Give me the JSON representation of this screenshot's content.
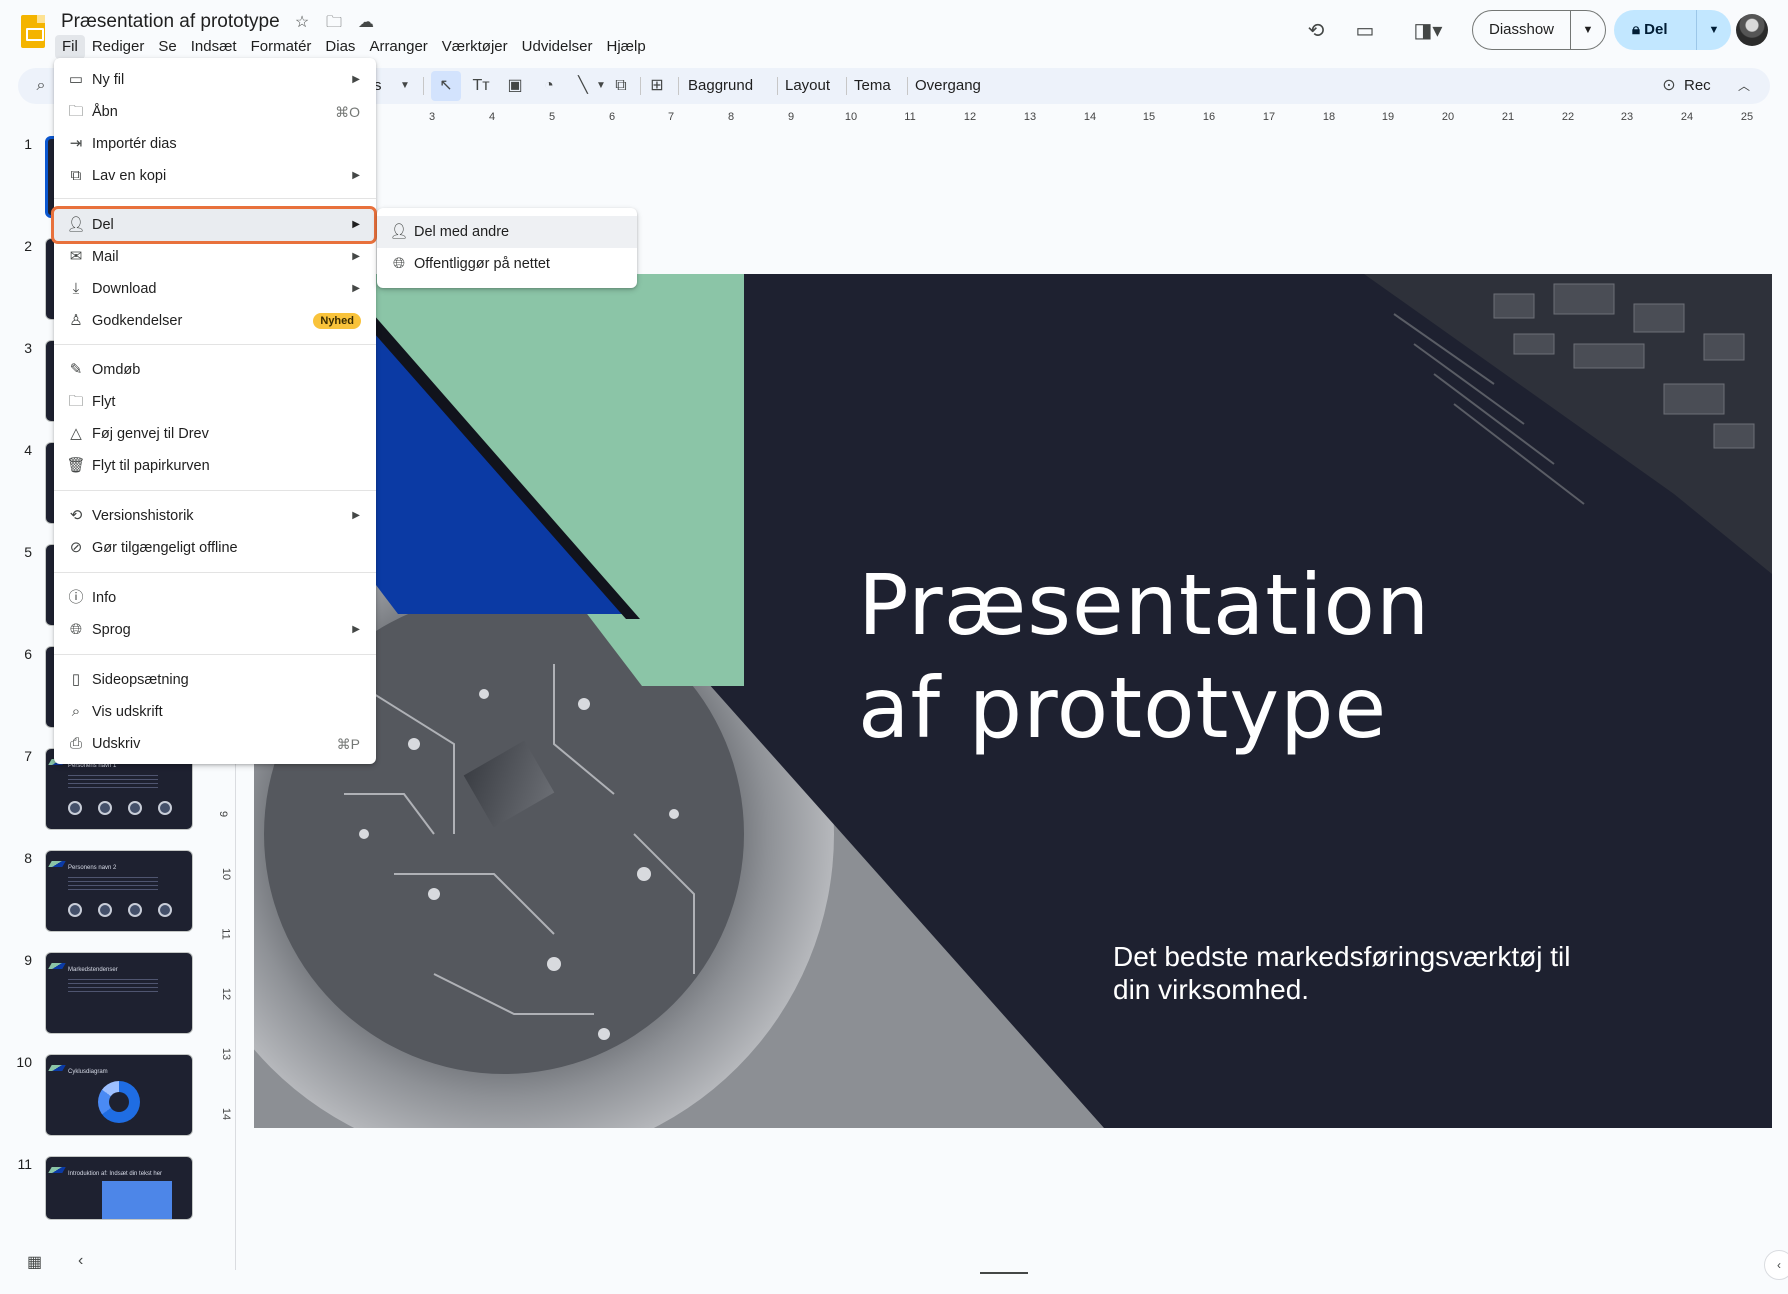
{
  "app": {
    "document_title": "Præsentation af prototype",
    "menus": [
      "Fil",
      "Rediger",
      "Se",
      "Indsæt",
      "Formatér",
      "Dias",
      "Arranger",
      "Værktøjer",
      "Udvidelser",
      "Hjælp"
    ],
    "active_menu": "Fil",
    "slideshow_label": "Diasshow",
    "share_label": "Del"
  },
  "toolbar": {
    "fragment_label": "s",
    "background_label": "Baggrund",
    "layout_label": "Layout",
    "theme_label": "Tema",
    "transition_label": "Overgang",
    "rec_label": "Rec"
  },
  "ruler": {
    "h_numbers": [
      "3",
      "4",
      "5",
      "6",
      "7",
      "8",
      "9",
      "10",
      "11",
      "12",
      "13",
      "14",
      "15",
      "16",
      "17",
      "18",
      "19",
      "20",
      "21",
      "22",
      "23",
      "24",
      "25"
    ],
    "v_numbers": [
      "9",
      "10",
      "11",
      "12",
      "13",
      "14"
    ]
  },
  "file_menu": {
    "items": [
      {
        "label": "Ny fil",
        "icon": "slides-file-icon",
        "submenu": true
      },
      {
        "label": "Åbn",
        "icon": "folder-icon",
        "shortcut": "⌘O"
      },
      {
        "label": "Importér dias",
        "icon": "import-icon"
      },
      {
        "label": "Lav en kopi",
        "icon": "copy-icon",
        "submenu": true
      },
      {
        "label": "Del",
        "icon": "person-add-icon",
        "submenu": true
      },
      {
        "label": "Mail",
        "icon": "mail-icon",
        "submenu": true
      },
      {
        "label": "Download",
        "icon": "download-icon",
        "submenu": true
      },
      {
        "label": "Godkendelser",
        "icon": "approval-icon",
        "badge": "Nyhed"
      },
      {
        "label": "Omdøb",
        "icon": "rename-icon"
      },
      {
        "label": "Flyt",
        "icon": "move-folder-icon"
      },
      {
        "label": "Føj genvej til Drev",
        "icon": "drive-shortcut-icon"
      },
      {
        "label": "Flyt til papirkurven",
        "icon": "trash-icon"
      },
      {
        "label": "Versionshistorik",
        "icon": "history-icon",
        "submenu": true
      },
      {
        "label": "Gør tilgængeligt offline",
        "icon": "offline-icon"
      },
      {
        "label": "Info",
        "icon": "info-icon"
      },
      {
        "label": "Sprog",
        "icon": "globe-icon",
        "submenu": true
      },
      {
        "label": "Sideopsætning",
        "icon": "page-setup-icon"
      },
      {
        "label": "Vis udskrift",
        "icon": "print-preview-icon"
      },
      {
        "label": "Udskriv",
        "icon": "printer-icon",
        "shortcut": "⌘P"
      }
    ],
    "highlighted": "Del"
  },
  "share_submenu": {
    "items": [
      {
        "label": "Del med andre",
        "icon": "person-add-icon"
      },
      {
        "label": "Offentliggør på nettet",
        "icon": "globe-icon"
      }
    ]
  },
  "filmstrip": {
    "slide_numbers": [
      "1",
      "2",
      "3",
      "4",
      "5",
      "6",
      "7",
      "8",
      "9",
      "10",
      "11"
    ],
    "thumb_titles": {
      "7": "Personens navn 1",
      "8": "Personens navn 2",
      "9": "Markedstendenser",
      "10": "Cyklusdiagram",
      "11": "Introduktion af: Indsæt din tekst her"
    }
  },
  "slide": {
    "title_line1": "Præsentation",
    "title_line2": "af prototype",
    "subtitle": "Det bedste markedsføringsværktøj til din virksomhed.",
    "colors": {
      "background": "#1e2130",
      "green": "#8bc5a7",
      "blue": "#0b3aa4"
    }
  }
}
